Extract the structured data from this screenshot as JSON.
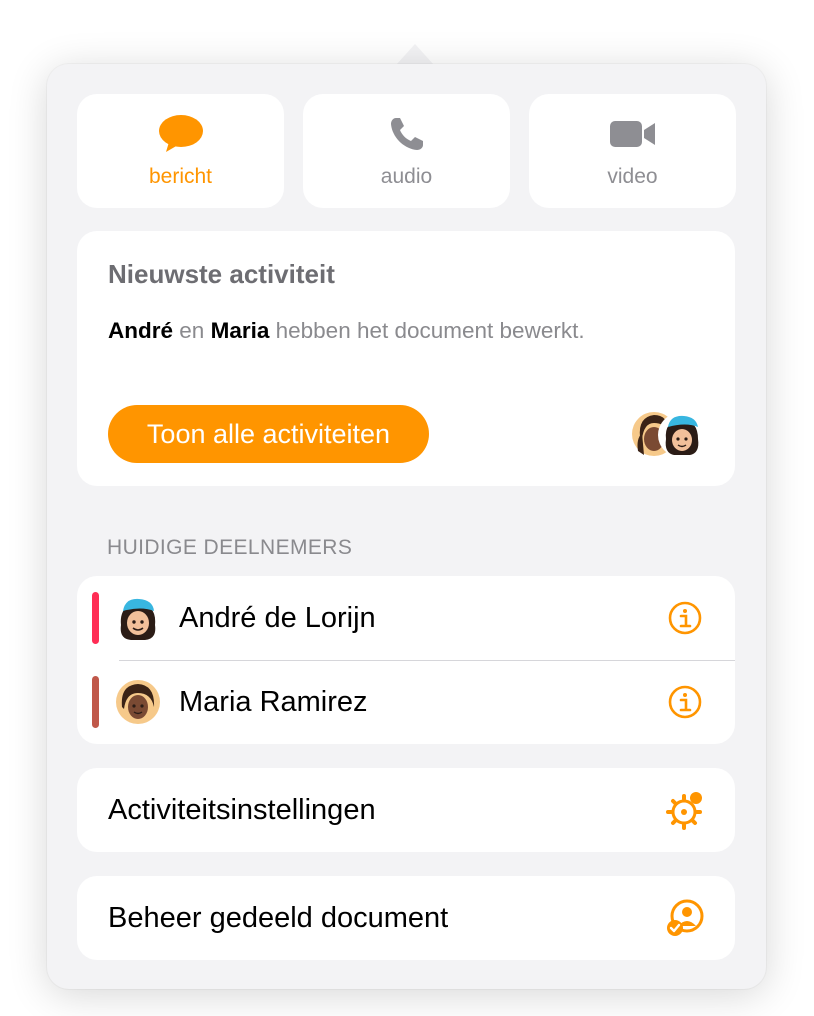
{
  "comm": {
    "message": {
      "label": "bericht",
      "icon": "speech-bubble-icon",
      "active": true
    },
    "audio": {
      "label": "audio",
      "icon": "phone-icon",
      "active": false
    },
    "video": {
      "label": "video",
      "icon": "video-camera-icon",
      "active": false
    }
  },
  "activity": {
    "title": "Nieuwste activiteit",
    "name1": "André",
    "conj": "en",
    "name2": "Maria",
    "text": "hebben het document bewerkt.",
    "button": "Toon alle activiteiten"
  },
  "participants": {
    "header": "HUIDIGE DEELNEMERS",
    "items": [
      {
        "name": "André de Lorijn",
        "color": "#ff2d55",
        "avatar": "memoji-blue-cap-avatar"
      },
      {
        "name": "Maria Ramirez",
        "color": "#c0584a",
        "avatar": "memoji-dark-hair-avatar"
      }
    ]
  },
  "actions": {
    "activity_settings": {
      "label": "Activiteitsinstellingen",
      "icon": "gear-badge-icon"
    },
    "manage_share": {
      "label": "Beheer gedeeld document",
      "icon": "person-check-icon"
    }
  },
  "colors": {
    "accent": "#ff9500",
    "panel": "#f3f3f5",
    "card": "#ffffff",
    "muted_text": "#8e8e93"
  }
}
